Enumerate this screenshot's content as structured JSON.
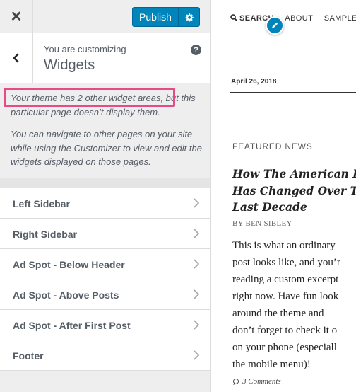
{
  "topbar": {
    "close_icon": "close-icon",
    "publish_label": "Publish",
    "settings_icon": "gear-icon"
  },
  "section": {
    "back_icon": "chevron-left-icon",
    "customizing_label": "You are customizing",
    "title": "Widgets",
    "help_icon": "?"
  },
  "notice": {
    "line1": "Your theme has 2 other widget areas, but this particular page doesn’t display them.",
    "line2": "You can navigate to other pages on your site while using the Customizer to view and edit the widgets displayed on those pages."
  },
  "widget_areas": [
    {
      "label": "Left Sidebar"
    },
    {
      "label": "Right Sidebar"
    },
    {
      "label": "Ad Spot - Below Header"
    },
    {
      "label": "Ad Spot - Above Posts"
    },
    {
      "label": "Ad Spot - After First Post"
    },
    {
      "label": "Footer"
    }
  ],
  "preview": {
    "nav": {
      "search": "SEARCH",
      "about": "ABOUT",
      "sample": "SAMPLE"
    },
    "date": "April 26, 2018",
    "category": "FEATURED NEWS",
    "post_title_lines": [
      "How The American D",
      "Has Changed Over Th",
      "Last Decade"
    ],
    "byline": "BY BEN SIBLEY",
    "excerpt_lines": [
      "This is what an ordinary",
      "post looks like, and you’r",
      "reading a custom excerpt",
      "right now. Have fun look",
      "around the theme and",
      "don’t forget to check it o",
      "on your phone (especiall",
      "the mobile menu)!"
    ],
    "comments": "3 Comments"
  },
  "colors": {
    "accent": "#0085ba",
    "highlight": "#e84a86",
    "panel_bg": "#eeeeee"
  }
}
